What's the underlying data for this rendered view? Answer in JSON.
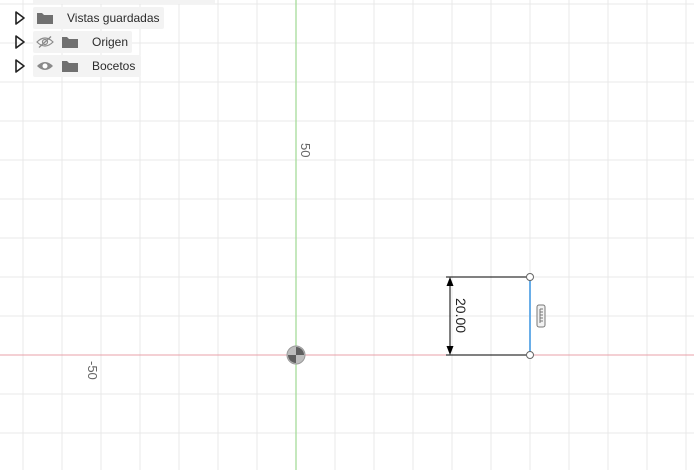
{
  "browser": {
    "items": [
      {
        "label": "Vistas guardadas",
        "visibility": "none",
        "icon": "folder-icon"
      },
      {
        "label": "Origen",
        "visibility": "hidden",
        "icon": "folder-icon"
      },
      {
        "label": "Bocetos",
        "visibility": "visible",
        "icon": "folder-icon"
      }
    ]
  },
  "canvas": {
    "axis_labels": {
      "y_positive": "50",
      "x_negative": "-50"
    },
    "dimension": {
      "value": "20.00"
    },
    "colors": {
      "x_axis": "#e8a0a8",
      "y_axis": "#a6dc9a",
      "grid": "#e9e9e9",
      "sketch_line": "#6aaee8",
      "dimension": "#000000"
    }
  }
}
